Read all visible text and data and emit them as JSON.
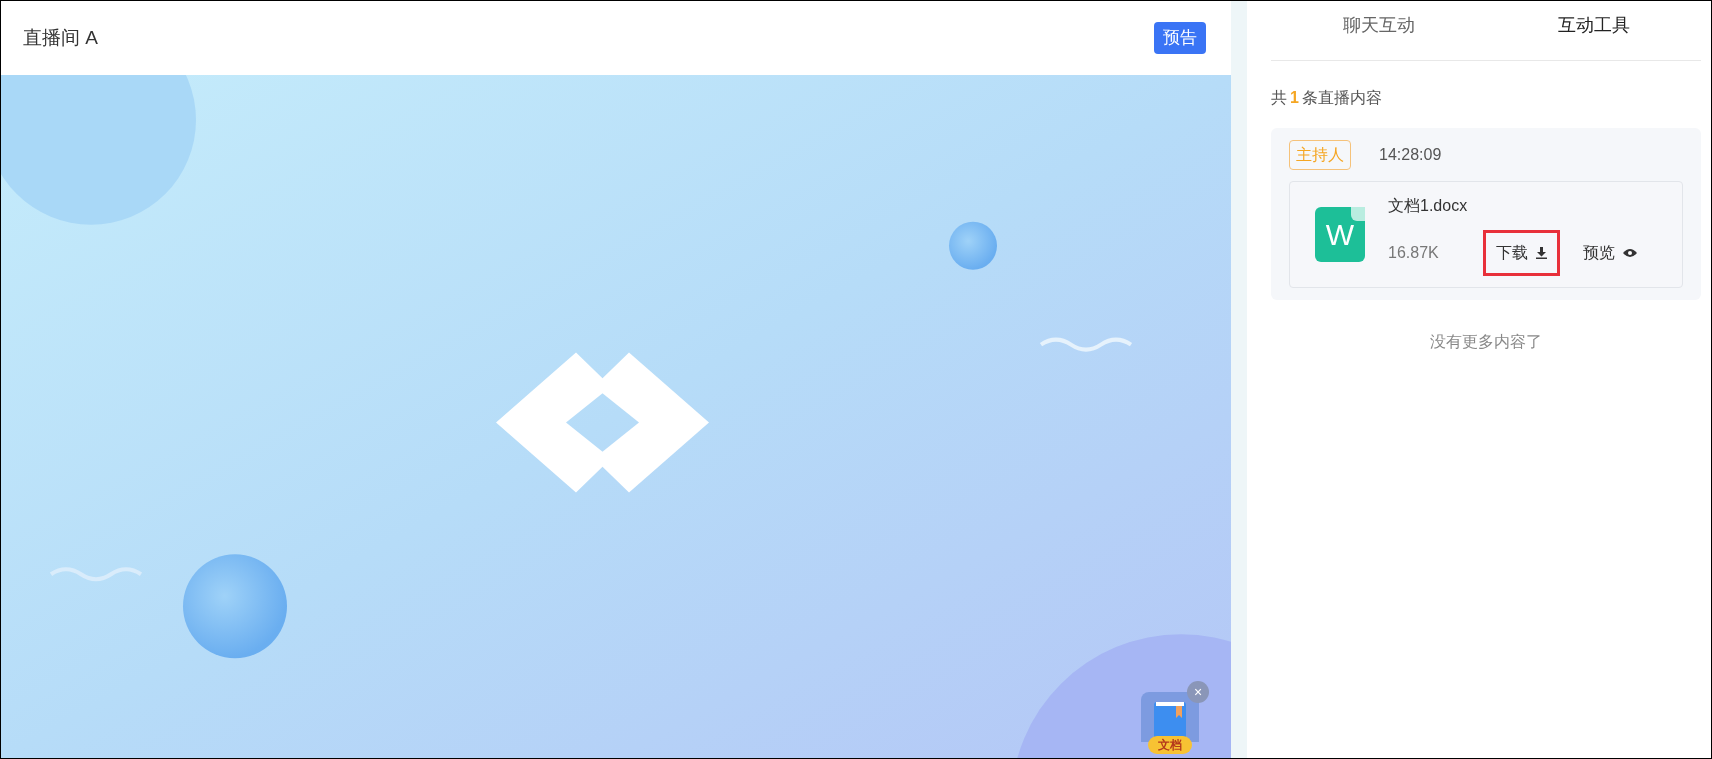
{
  "room": {
    "title": "直播间 A",
    "badge": "预告"
  },
  "widget": {
    "label": "文档",
    "close": "×"
  },
  "tabs": [
    {
      "label": "聊天互动",
      "selected": false
    },
    {
      "label": "互动工具",
      "selected": true
    }
  ],
  "summary": {
    "prefix": "共",
    "count": "1",
    "suffix": "条直播内容"
  },
  "messages": [
    {
      "role": "主持人",
      "time": "14:28:09",
      "file": {
        "kind": "word",
        "icon_letter": "W",
        "name": "文档1.docx",
        "size": "16.87K",
        "actions": [
          {
            "kind": "download",
            "label": "下载",
            "highlighted": true
          },
          {
            "kind": "preview",
            "label": "预览",
            "highlighted": false
          }
        ]
      }
    }
  ],
  "footer": "没有更多内容了"
}
